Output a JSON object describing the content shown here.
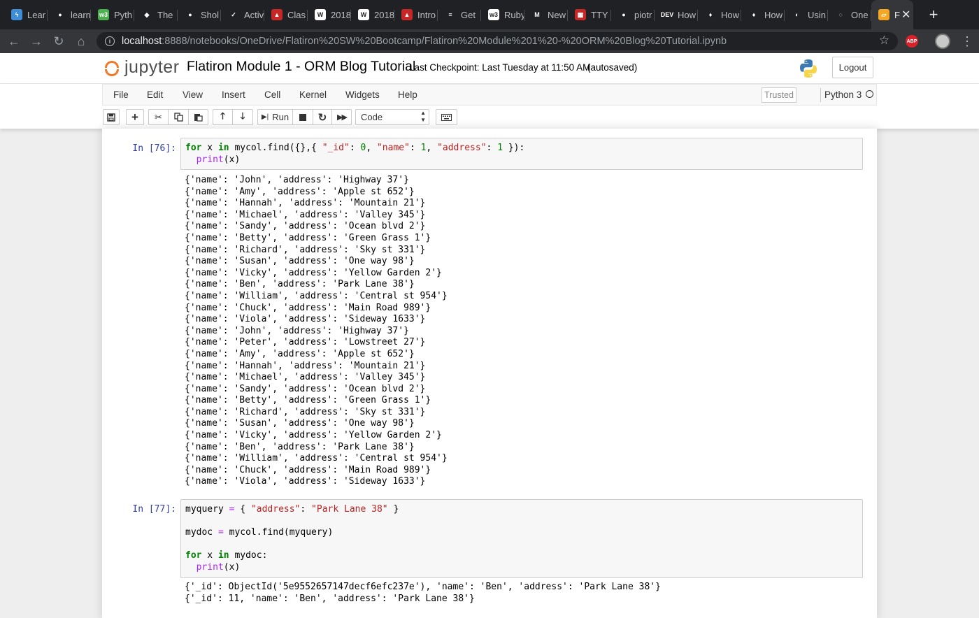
{
  "browser": {
    "tabs": [
      {
        "label": "Lear",
        "fav_color": "#3d8ed6",
        "fav_glyph": "ϟ"
      },
      {
        "label": "learn",
        "fav_color": "#202124",
        "fav_glyph": "●"
      },
      {
        "label": "Pyth",
        "fav_color": "#4caf50",
        "fav_glyph": "w3"
      },
      {
        "label": "The",
        "fav_color": "#202124",
        "fav_glyph": "◆"
      },
      {
        "label": "Shol",
        "fav_color": "#202124",
        "fav_glyph": "●"
      },
      {
        "label": "Activ",
        "fav_color": "#202124",
        "fav_glyph": "✓"
      },
      {
        "label": "Clas",
        "fav_color": "#c62828",
        "fav_glyph": "▲"
      },
      {
        "label": "2018",
        "fav_color": "#ffffff",
        "fav_glyph": "W"
      },
      {
        "label": "2018",
        "fav_color": "#ffffff",
        "fav_glyph": "W"
      },
      {
        "label": "Intro",
        "fav_color": "#c62828",
        "fav_glyph": "▲"
      },
      {
        "label": "Get",
        "fav_color": "#202124",
        "fav_glyph": "≡"
      },
      {
        "label": "Ruby",
        "fav_color": "#ffffff",
        "fav_glyph": "w3"
      },
      {
        "label": "New",
        "fav_color": "#202124",
        "fav_glyph": "M"
      },
      {
        "label": "TTY",
        "fav_color": "#c62828",
        "fav_glyph": "▦"
      },
      {
        "label": "piotr",
        "fav_color": "#202124",
        "fav_glyph": "●"
      },
      {
        "label": "How",
        "fav_color": "#202124",
        "fav_glyph": "DEV"
      },
      {
        "label": "How",
        "fav_color": "#202124",
        "fav_glyph": "♦"
      },
      {
        "label": "How",
        "fav_color": "#202124",
        "fav_glyph": "♦"
      },
      {
        "label": "Usin",
        "fav_color": "#202124",
        "fav_glyph": "◐"
      },
      {
        "label": "One",
        "fav_color": "#202124",
        "fav_glyph": "◌"
      }
    ],
    "active_tab": {
      "label": "F"
    },
    "url_host": "localhost",
    "url_rest": ":8888/notebooks/OneDrive/Flatiron%20SW%20Bootcamp/Flatiron%20Module%201%20-%20ORM%20Blog%20Tutorial.ipynb",
    "abp_label": "ABP"
  },
  "header": {
    "logo_text": "jupyter",
    "notebook_title": "Flatiron Module 1 - ORM Blog Tutorial",
    "checkpoint": "Last Checkpoint: Last Tuesday at 11:50 AM",
    "autosaved": "(autosaved)",
    "logout_label": "Logout"
  },
  "menubar": {
    "items": [
      "File",
      "Edit",
      "View",
      "Insert",
      "Cell",
      "Kernel",
      "Widgets",
      "Help"
    ],
    "trusted": "Trusted",
    "kernel_name": "Python 3"
  },
  "toolbar": {
    "run_label": "Run",
    "cell_type": "Code"
  },
  "cells": [
    {
      "prompt": "In [76]:",
      "output": [
        "{'name': 'John', 'address': 'Highway 37'}",
        "{'name': 'Amy', 'address': 'Apple st 652'}",
        "{'name': 'Hannah', 'address': 'Mountain 21'}",
        "{'name': 'Michael', 'address': 'Valley 345'}",
        "{'name': 'Sandy', 'address': 'Ocean blvd 2'}",
        "{'name': 'Betty', 'address': 'Green Grass 1'}",
        "{'name': 'Richard', 'address': 'Sky st 331'}",
        "{'name': 'Susan', 'address': 'One way 98'}",
        "{'name': 'Vicky', 'address': 'Yellow Garden 2'}",
        "{'name': 'Ben', 'address': 'Park Lane 38'}",
        "{'name': 'William', 'address': 'Central st 954'}",
        "{'name': 'Chuck', 'address': 'Main Road 989'}",
        "{'name': 'Viola', 'address': 'Sideway 1633'}",
        "{'name': 'John', 'address': 'Highway 37'}",
        "{'name': 'Peter', 'address': 'Lowstreet 27'}",
        "{'name': 'Amy', 'address': 'Apple st 652'}",
        "{'name': 'Hannah', 'address': 'Mountain 21'}",
        "{'name': 'Michael', 'address': 'Valley 345'}",
        "{'name': 'Sandy', 'address': 'Ocean blvd 2'}",
        "{'name': 'Betty', 'address': 'Green Grass 1'}",
        "{'name': 'Richard', 'address': 'Sky st 331'}",
        "{'name': 'Susan', 'address': 'One way 98'}",
        "{'name': 'Vicky', 'address': 'Yellow Garden 2'}",
        "{'name': 'Ben', 'address': 'Park Lane 38'}",
        "{'name': 'William', 'address': 'Central st 954'}",
        "{'name': 'Chuck', 'address': 'Main Road 989'}",
        "{'name': 'Viola', 'address': 'Sideway 1633'}"
      ]
    },
    {
      "prompt": "In [77]:",
      "output": [
        "{'_id': ObjectId('5e9552657147decf6efc237e'), 'name': 'Ben', 'address': 'Park Lane 38'}",
        "{'_id': 11, 'name': 'Ben', 'address': 'Park Lane 38'}"
      ]
    }
  ],
  "code": {
    "c76_l1": {
      "kw1": "for",
      "v1": " x ",
      "kw2": "in",
      "v2": " mycol.find({},{ ",
      "s1": "\"_id\"",
      "c1": ": ",
      "n1": "0",
      "c2": ", ",
      "s2": "\"name\"",
      "c3": ": ",
      "n2": "1",
      "c4": ", ",
      "s3": "\"address\"",
      "c5": ": ",
      "n3": "1",
      "c6": " }):"
    },
    "c76_l2": {
      "bi": "print",
      "rest": "(x)"
    },
    "c77_l1": {
      "v1": "myquery ",
      "op": "=",
      "v2": " { ",
      "s1": "\"address\"",
      "c1": ": ",
      "s2": "\"Park Lane 38\"",
      "c2": " }"
    },
    "c77_l3": {
      "v1": "mydoc ",
      "op": "=",
      "v2": " mycol.find(myquery)"
    },
    "c77_l5": {
      "kw1": "for",
      "v1": " x ",
      "kw2": "in",
      "v2": " mydoc:"
    },
    "c77_l6": {
      "bi": "print",
      "rest": "(x)"
    }
  },
  "colors": {
    "chrome_bg": "#202124",
    "jupyter_orange": "#f37726",
    "prompt_blue": "#303f9f",
    "keyword_green": "#008000",
    "string_red": "#ba2121"
  }
}
